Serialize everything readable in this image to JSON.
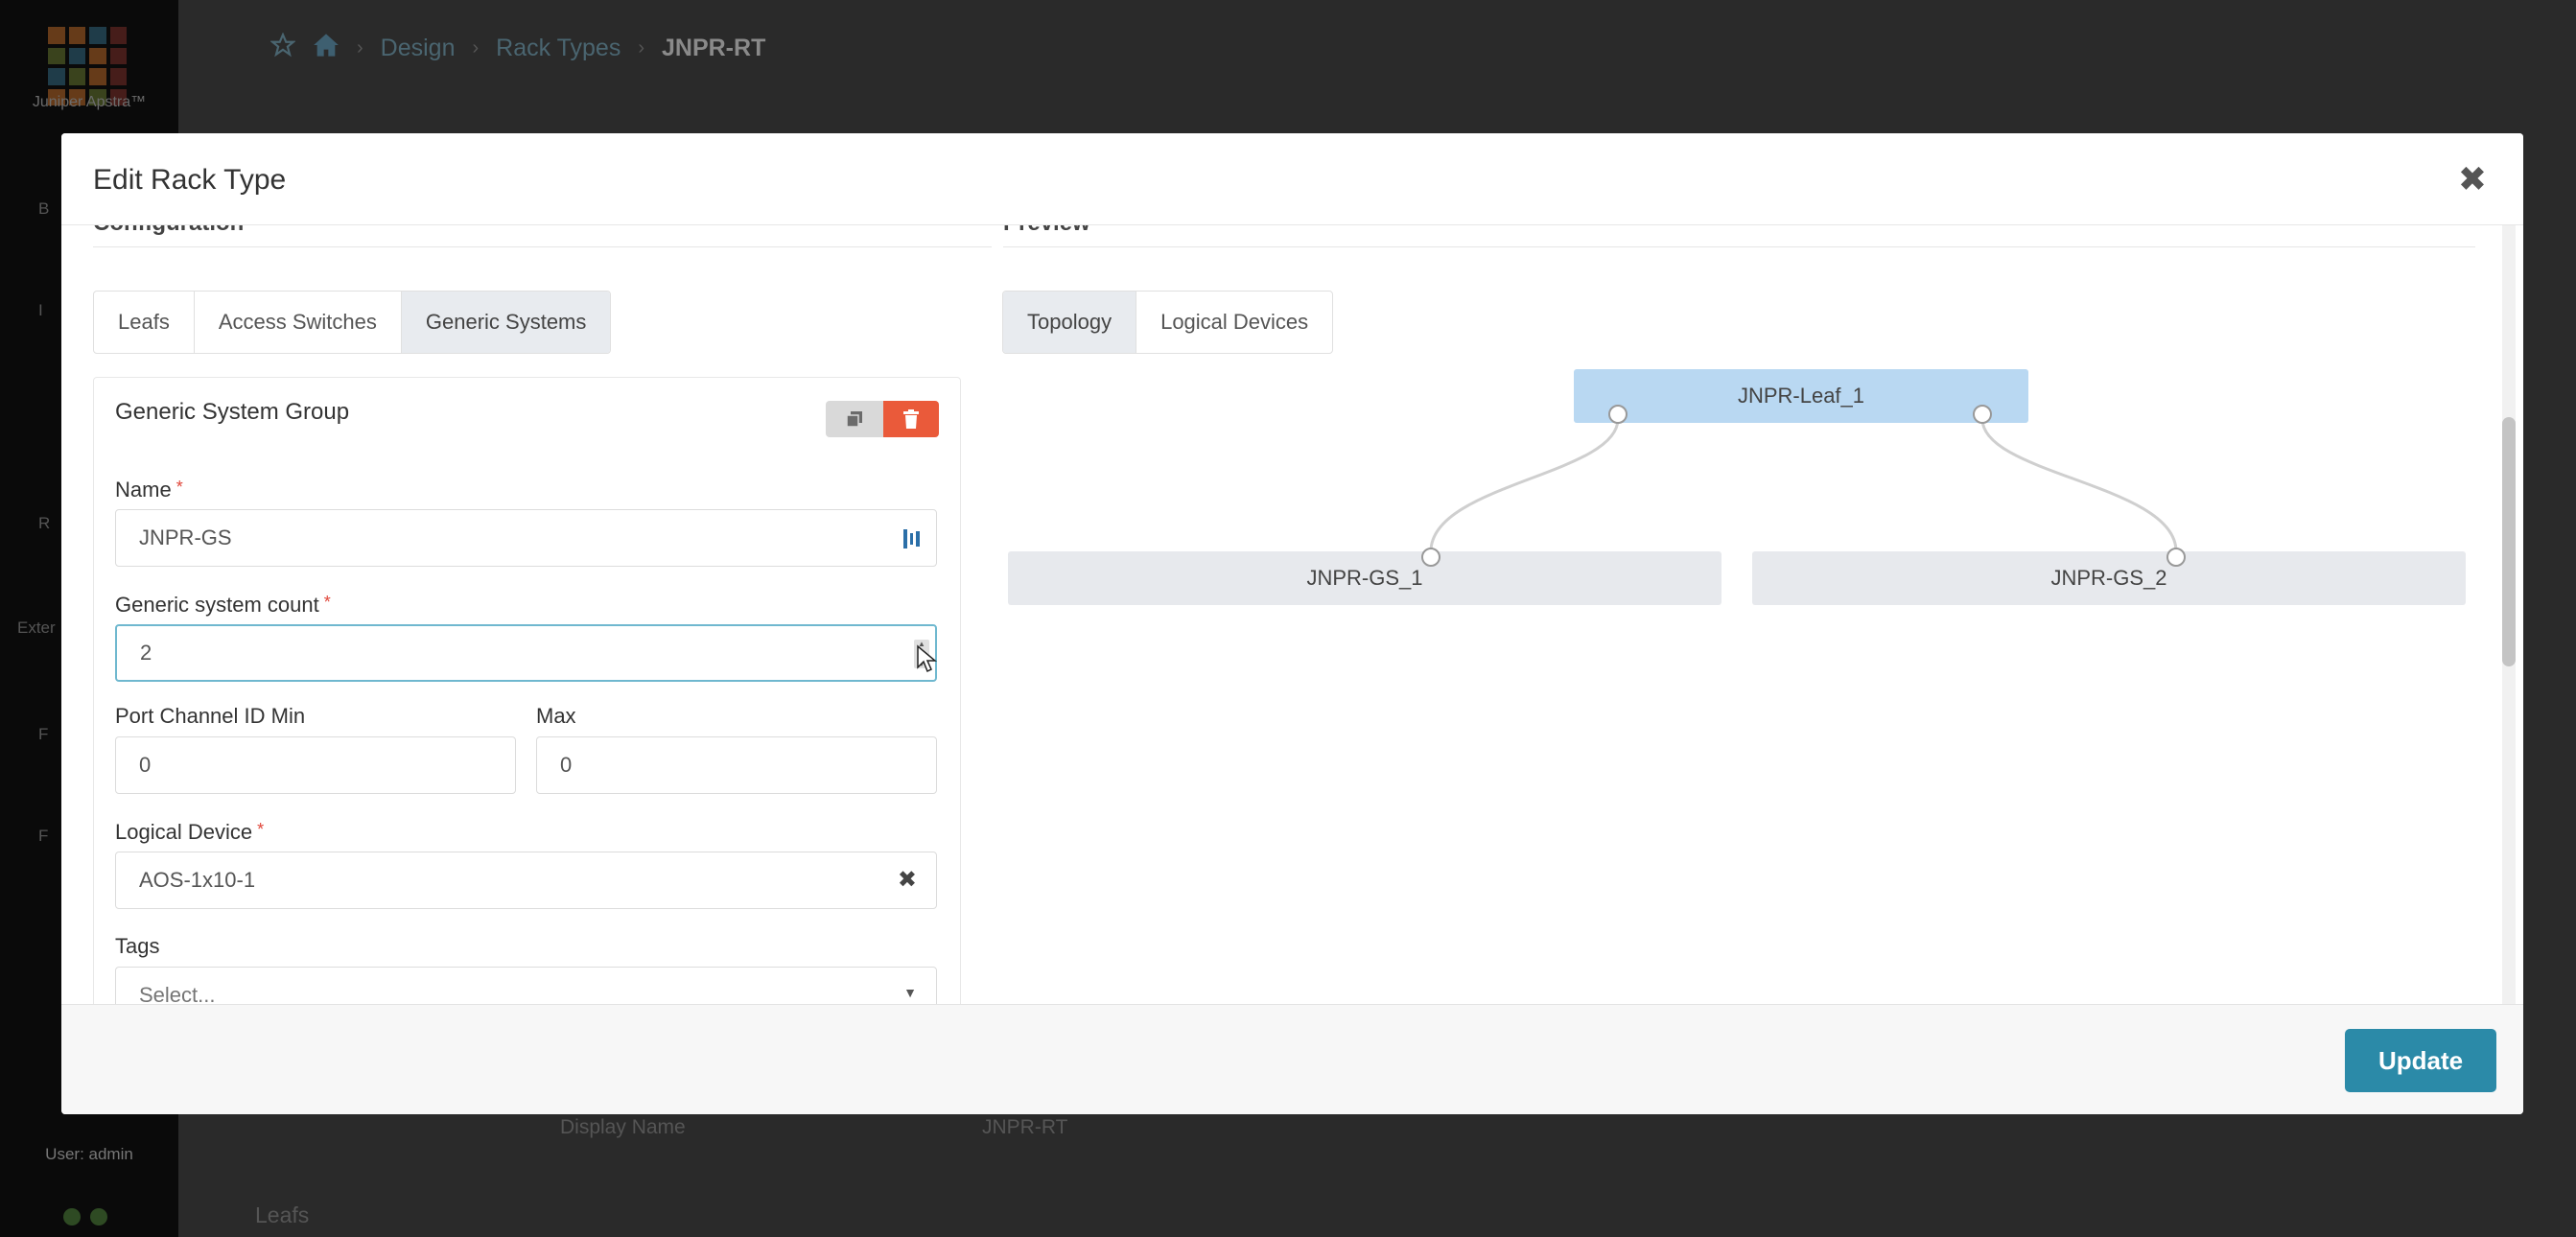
{
  "app": {
    "logo_text": "Juniper Apstra™",
    "sidebar_fragments": [
      "B",
      "I",
      "R",
      "Exter",
      "F",
      "F"
    ],
    "user_label": "User: admin"
  },
  "breadcrumb": {
    "items": [
      "Design",
      "Rack Types",
      "JNPR-RT"
    ]
  },
  "background": {
    "display_name_label": "Display Name",
    "display_name_value": "JNPR-RT",
    "leafs_heading": "Leafs"
  },
  "modal": {
    "title": "Edit Rack Type",
    "close_glyph": "✖",
    "update_label": "Update",
    "configuration": {
      "heading": "Configuration",
      "tabs": [
        {
          "label": "Leafs",
          "active": false
        },
        {
          "label": "Access Switches",
          "active": false
        },
        {
          "label": "Generic Systems",
          "active": true
        }
      ],
      "group": {
        "title": "Generic System Group",
        "name_label": "Name",
        "name_value": "JNPR-GS",
        "count_label": "Generic system count",
        "count_value": "2",
        "port_channel_min_label": "Port Channel ID Min",
        "port_channel_min_value": "0",
        "port_channel_max_label": "Max",
        "port_channel_max_value": "0",
        "logical_device_label": "Logical Device",
        "logical_device_value": "AOS-1x10-1",
        "tags_label": "Tags",
        "tags_placeholder": "Select..."
      }
    },
    "preview": {
      "heading": "Preview",
      "tabs": [
        {
          "label": "Topology",
          "active": true
        },
        {
          "label": "Logical Devices",
          "active": false
        }
      ],
      "topology": {
        "leaf": "JNPR-Leaf_1",
        "generic_systems": [
          "JNPR-GS_1",
          "JNPR-GS_2"
        ]
      }
    }
  },
  "colors": {
    "accent": "#2b8aa8",
    "delete": "#ea5a3a",
    "leaf_node": "#b9d8f2",
    "gs_node": "#e7e9ed"
  },
  "icons": {
    "close": "close-icon",
    "clone": "clone-icon",
    "delete": "trash-icon",
    "home": "home-icon",
    "star": "star-icon",
    "clear": "clear-icon",
    "dropdown": "chevron-down-icon"
  }
}
